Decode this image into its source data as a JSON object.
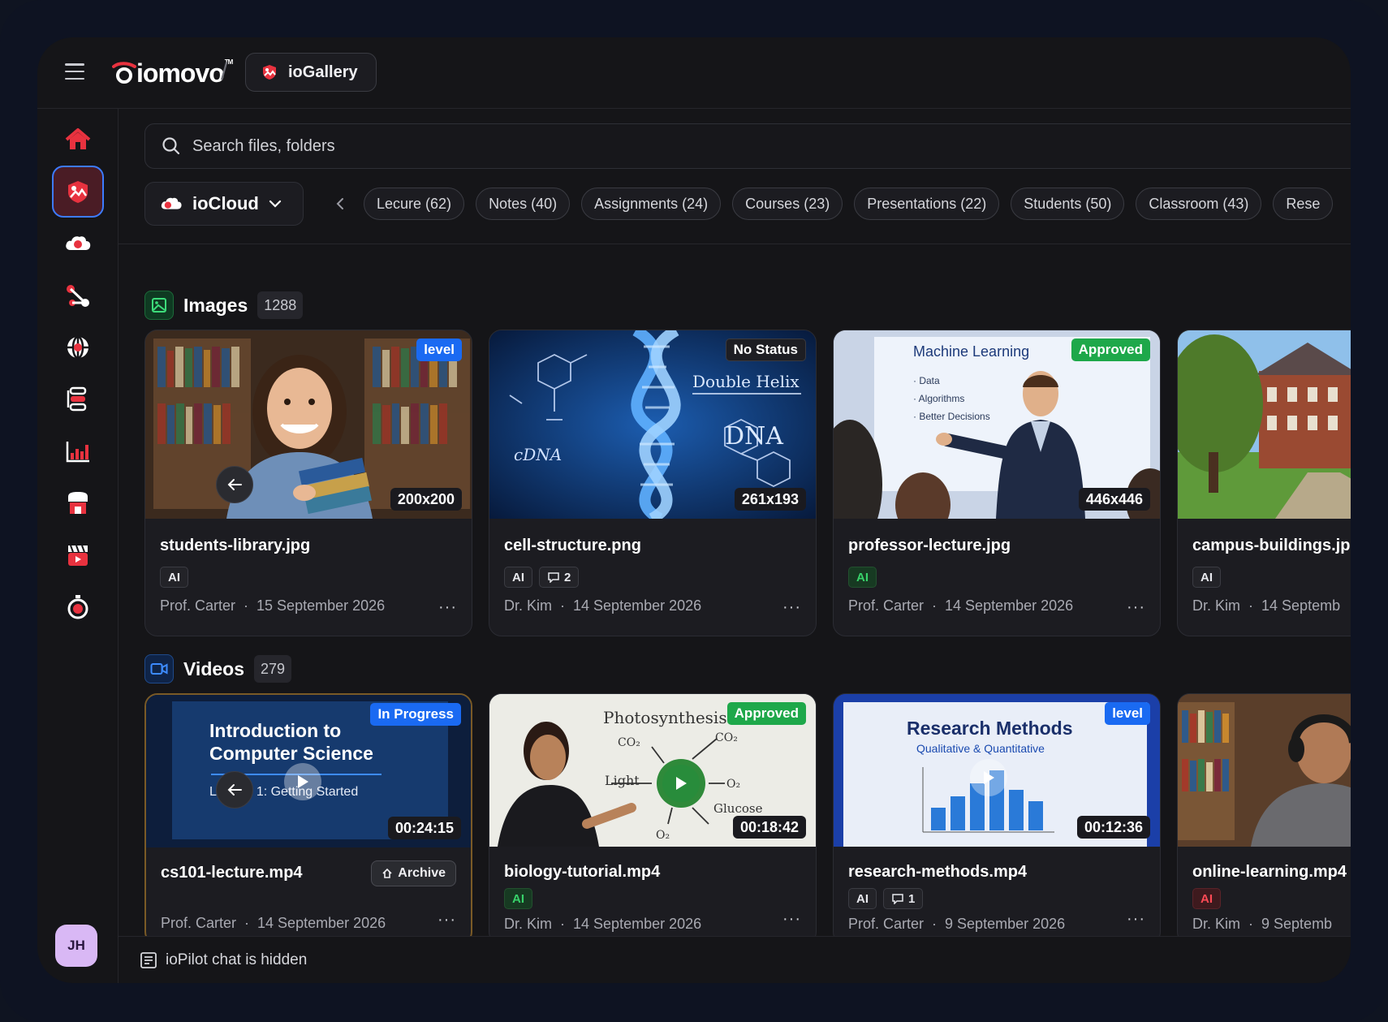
{
  "app": {
    "logo_text": "iomovo",
    "logo_tm": "TM",
    "workspace_label": "ioGallery"
  },
  "search": {
    "placeholder": "Search files, folders"
  },
  "storage": {
    "selected": "ioCloud"
  },
  "filters": [
    "Lecure (62)",
    "Notes (40)",
    "Assignments (24)",
    "Courses (23)",
    "Presentations (22)",
    "Students (50)",
    "Classroom (43)",
    "Rese"
  ],
  "images_section": {
    "title": "Images",
    "count": "1288",
    "cards": [
      {
        "name": "students-library.jpg",
        "status": "level",
        "dims": "200x200",
        "tags": [
          "AI"
        ],
        "author": "Prof. Carter",
        "date": "15 September 2026"
      },
      {
        "name": "cell-structure.png",
        "status": "No Status",
        "dims": "261x193",
        "tags": [
          "AI"
        ],
        "comments": "2",
        "author": "Dr. Kim",
        "date": "14 September 2026",
        "image_text": [
          "Double Helix",
          "DNA"
        ]
      },
      {
        "name": "professor-lecture.jpg",
        "status": "Approved",
        "dims": "446x446",
        "tags": [
          "AI"
        ],
        "author": "Prof. Carter",
        "date": "14 September 2026",
        "image_text": [
          "Machine Learning",
          "· Data",
          "· Algorithms",
          "· Better Decisions"
        ]
      },
      {
        "name": "campus-buildings.jp",
        "tags": [
          "AI"
        ],
        "author": "Dr. Kim",
        "date": "14 Septemb"
      }
    ]
  },
  "videos_section": {
    "title": "Videos",
    "count": "279",
    "cards": [
      {
        "name": "cs101-lecture.mp4",
        "status": "In Progress",
        "duration": "00:24:15",
        "archive_label": "Archive",
        "author": "Prof. Carter",
        "date": "14 September 2026",
        "image_text": [
          "Introduction to",
          "Computer Science",
          "Lecture 1: Getting Started"
        ]
      },
      {
        "name": "biology-tutorial.mp4",
        "status": "Approved",
        "duration": "00:18:42",
        "tags": [
          "AI"
        ],
        "author": "Dr. Kim",
        "date": "14 September 2026",
        "image_text": [
          "Photosynthesis",
          "Light",
          "Glucose"
        ]
      },
      {
        "name": "research-methods.mp4",
        "status": "level",
        "duration": "00:12:36",
        "tags": [
          "AI"
        ],
        "comments": "1",
        "author": "Prof. Carter",
        "date": "9 September 2026",
        "image_text": [
          "Research Methods",
          "Qualitative & Quantitative"
        ]
      },
      {
        "name": "online-learning.mp4",
        "tags": [
          "AI"
        ],
        "author": "Dr. Kim",
        "date": "9 Septemb"
      }
    ]
  },
  "user": {
    "initials": "JH"
  },
  "chat": {
    "hidden_text": "ioPilot chat is hidden"
  },
  "colors": {
    "accent_red": "#e8323f",
    "status_blue": "#1a6af2",
    "status_green": "#1ea84a"
  },
  "icons": [
    "menu-icon",
    "home-icon",
    "gallery-icon",
    "cloud-icon",
    "share-icon",
    "globe-icon",
    "workflow-icon",
    "analytics-icon",
    "store-icon",
    "video-icon",
    "timer-icon",
    "search-icon",
    "chevron-down-icon",
    "chevron-left-icon",
    "image-icon",
    "video-camera-icon",
    "arrow-left-icon",
    "comment-icon",
    "archive-icon",
    "more-icon",
    "chat-icon",
    "play-icon"
  ]
}
